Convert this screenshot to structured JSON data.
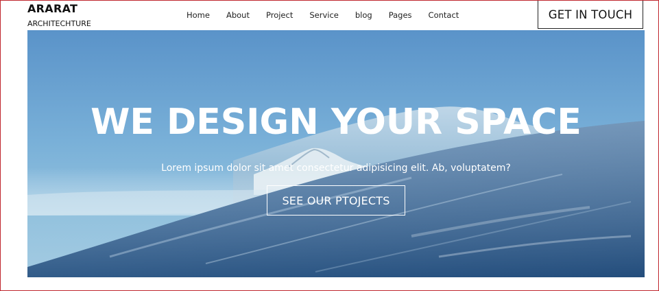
{
  "brand": {
    "name": "ARARAT",
    "tagline": "ARCHITECHTURE"
  },
  "nav": {
    "items": [
      "Home",
      "About",
      "Project",
      "Service",
      "blog",
      "Pages",
      "Contact"
    ]
  },
  "cta": {
    "label": "GET IN TOUCH"
  },
  "hero": {
    "title": "WE DESIGN YOUR SPACE",
    "subtitle": "Lorem ipsum dolor sit amet consectetur adipisicing elit. Ab, voluptatem?",
    "button_label": "SEE OUR PTOJECTS",
    "background": "snowy-mountain-slope-photo"
  },
  "colors": {
    "frame_border": "#c0262d",
    "sky": "#6ea7d3",
    "text_light": "#ffffff",
    "text_dark": "#111111"
  }
}
